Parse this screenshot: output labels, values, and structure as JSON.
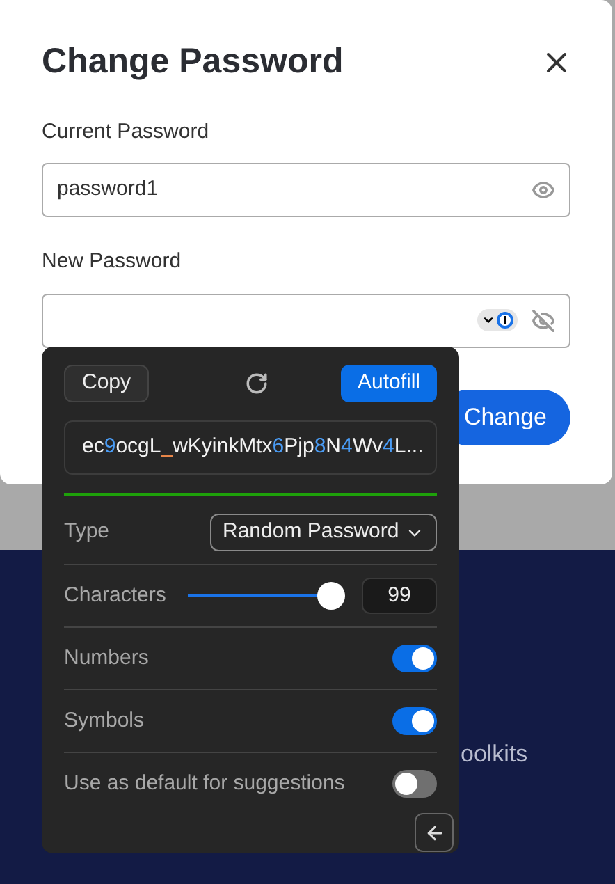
{
  "background": {
    "partial_text": "oolkits"
  },
  "dialog": {
    "title": "Change Password",
    "fields": [
      {
        "label": "Current Password",
        "value": "password1",
        "revealed": true
      },
      {
        "label": "New Password",
        "revealed": false
      }
    ],
    "submit": "Change"
  },
  "generator": {
    "copy": "Copy",
    "autofill": "Autofill",
    "password": "ec9ocgL_wKyinkMtx6Pjp8N4Wv4L...",
    "strength": {
      "level": 1
    },
    "rows": [
      {
        "kind": "select",
        "label": "Type",
        "value": "Random Password"
      },
      {
        "kind": "slider",
        "label": "Characters",
        "level": 0.92,
        "value": "99"
      },
      {
        "kind": "toggle",
        "label": "Numbers",
        "on": true
      },
      {
        "kind": "toggle",
        "label": "Symbols",
        "on": true
      },
      {
        "kind": "toggle",
        "label": "Use as default for suggestions",
        "on": false
      }
    ]
  }
}
